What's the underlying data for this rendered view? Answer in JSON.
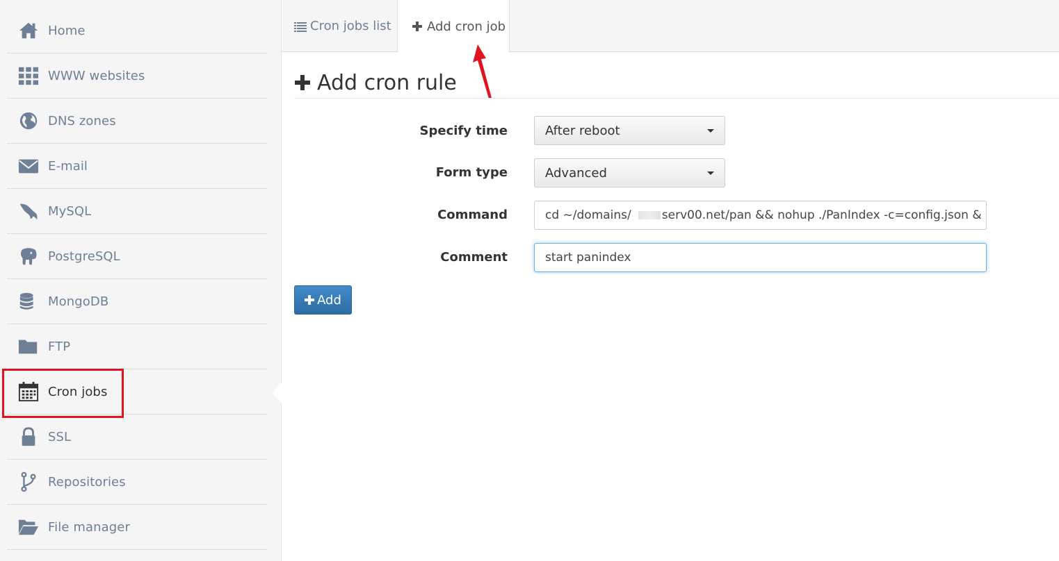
{
  "sidebar": {
    "items": [
      {
        "label": "Home",
        "icon": "home-icon"
      },
      {
        "label": "WWW websites",
        "icon": "grid-icon"
      },
      {
        "label": "DNS zones",
        "icon": "globe-icon"
      },
      {
        "label": "E-mail",
        "icon": "envelope-icon"
      },
      {
        "label": "MySQL",
        "icon": "dolphin-icon"
      },
      {
        "label": "PostgreSQL",
        "icon": "elephant-icon"
      },
      {
        "label": "MongoDB",
        "icon": "database-icon"
      },
      {
        "label": "FTP",
        "icon": "folder-icon"
      },
      {
        "label": "Cron jobs",
        "icon": "calendar-icon",
        "active": true
      },
      {
        "label": "SSL",
        "icon": "lock-icon"
      },
      {
        "label": "Repositories",
        "icon": "branch-icon"
      },
      {
        "label": "File manager",
        "icon": "folder-open-icon"
      }
    ]
  },
  "tabs": [
    {
      "label": "Cron jobs list",
      "icon": "list-icon"
    },
    {
      "label": "Add cron job",
      "icon": "plus-icon",
      "active": true
    }
  ],
  "main": {
    "title": "Add cron rule",
    "form": {
      "specify_time": {
        "label": "Specify time",
        "value": "After reboot"
      },
      "form_type": {
        "label": "Form type",
        "value": "Advanced"
      },
      "command": {
        "label": "Command",
        "value_prefix": "cd ~/domains/",
        "value_suffix": "serv00.net/pan && nohup ./PanIndex -c=config.json &"
      },
      "comment": {
        "label": "Comment",
        "value": "start panindex"
      }
    },
    "submit_label": "Add"
  },
  "colors": {
    "accent": "#428bca",
    "sidebar_text": "#6f7f96",
    "annotation_red": "#e0141e",
    "focus": "#66afe9"
  }
}
